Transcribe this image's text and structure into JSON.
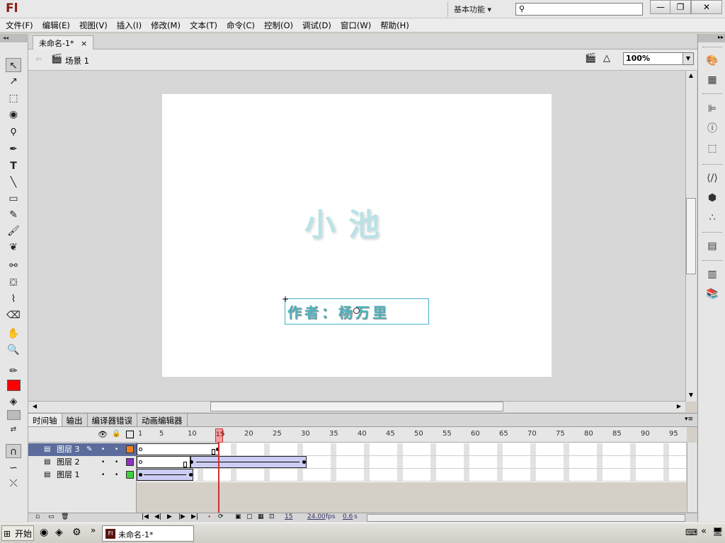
{
  "app": {
    "logo": "Fl",
    "workspace": "基本功能",
    "workspace_arrow": "▾"
  },
  "window_controls": {
    "minimize": "—",
    "restore": "❐",
    "close": "✕"
  },
  "menu": [
    "文件(F)",
    "编辑(E)",
    "视图(V)",
    "插入(I)",
    "修改(M)",
    "文本(T)",
    "命令(C)",
    "控制(O)",
    "调试(D)",
    "窗口(W)",
    "帮助(H)"
  ],
  "document": {
    "tab_title": "未命名-1*",
    "tab_close": "×",
    "scene": "场景 1",
    "zoom": "100%"
  },
  "stage": {
    "title_text": "小池",
    "author_text": "作者：杨万里"
  },
  "timeline": {
    "tabs": [
      "时间轴",
      "输出",
      "编译器错误",
      "动画编辑器"
    ],
    "frame_numbers": [
      "1",
      "5",
      "10",
      "15",
      "20",
      "25",
      "30",
      "35",
      "40",
      "45",
      "50",
      "55",
      "60",
      "65",
      "70",
      "75",
      "80",
      "85",
      "90",
      "95"
    ],
    "layers": [
      {
        "name": "图层 3",
        "color": "#f08020",
        "selected": true
      },
      {
        "name": "图层 2",
        "color": "#9030c0",
        "selected": false
      },
      {
        "name": "图层 1",
        "color": "#40d040",
        "selected": false
      }
    ],
    "current_frame": "15",
    "fps": "24.00",
    "fps_unit": "fps",
    "elapsed": "0.6",
    "elapsed_unit": "s"
  },
  "colors": {
    "stroke": "#000000",
    "fill": "#ff0000"
  },
  "taskbar": {
    "start": "开始",
    "task": "未命名-1*"
  }
}
